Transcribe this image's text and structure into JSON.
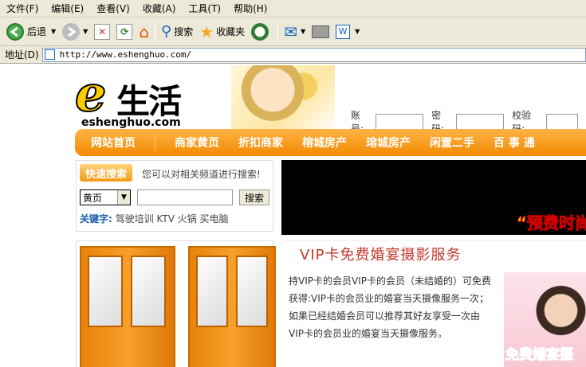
{
  "menu": [
    "文件(F)",
    "编辑(E)",
    "查看(V)",
    "收藏(A)",
    "工具(T)",
    "帮助(H)"
  ],
  "toolbar": {
    "back": "后退",
    "search": "搜索",
    "favorites": "收藏夹"
  },
  "address": {
    "label": "地址(D)",
    "url": "http://www.eshenghuo.com/"
  },
  "logo": {
    "mark": "e",
    "chinese": "生活",
    "domain": "eshenghuo.com"
  },
  "login": {
    "account": "账号:",
    "password": "密码:",
    "captcha": "校验码:"
  },
  "nav": [
    "网站首页",
    "商家黄页",
    "折扣商家",
    "榕城房产",
    "瑢城房产",
    "闲置二手",
    "百 事 通"
  ],
  "search": {
    "tab": "快速搜索",
    "hint": "您可以对相关频道进行搜索!",
    "select": "黄页",
    "button": "搜索",
    "keywords_label": "关键字:",
    "keywords": "驾驶培训 KTV 火锅 买电脑"
  },
  "banner": {
    "text": "“预费时尚"
  },
  "vip": {
    "title": "VIP卡免费婚宴摄影服务",
    "body": "持VIP卡的会员VIP卡的会员（未结婚的）可免费获得:VIP卡的会员业的婚宴当天摄像服务一次；如果已经结婚会员可以推荐其好友享受一次由VIP卡的会员业的婚宴当天摄像服务。",
    "image_caption": "免费婚宴摄"
  },
  "colors": {
    "orange": "#f28a00",
    "title_red": "#c0392b"
  }
}
